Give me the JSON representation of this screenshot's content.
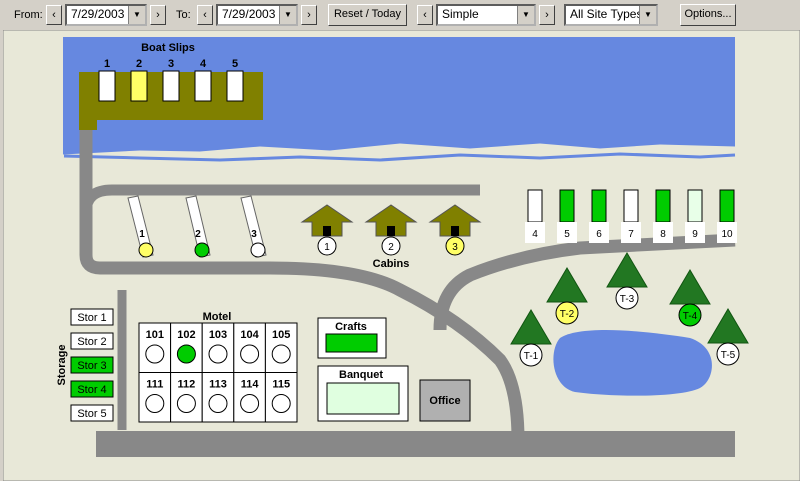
{
  "toolbar": {
    "from_label": "From:",
    "from_date": "7/29/2003",
    "to_label": "To:",
    "to_date": "7/29/2003",
    "reset_label": "Reset / Today",
    "view_value": "Simple",
    "site_type_value": "All Site Types",
    "options_label": "Options..."
  },
  "map": {
    "boat_slips_title": "Boat Slips",
    "boat_slips": [
      {
        "label": "1",
        "status": "available"
      },
      {
        "label": "2",
        "status": "reserved"
      },
      {
        "label": "3",
        "status": "available"
      },
      {
        "label": "4",
        "status": "available"
      },
      {
        "label": "5",
        "status": "available"
      }
    ],
    "rv_sites": [
      {
        "label": "1",
        "status": "reserved"
      },
      {
        "label": "2",
        "status": "occupied"
      },
      {
        "label": "3",
        "status": "available"
      }
    ],
    "cabins_title": "Cabins",
    "cabins": [
      {
        "label": "1",
        "status": "available"
      },
      {
        "label": "2",
        "status": "available"
      },
      {
        "label": "3",
        "status": "reserved"
      }
    ],
    "slots": [
      {
        "label": "4",
        "status": "available"
      },
      {
        "label": "5",
        "status": "occupied"
      },
      {
        "label": "6",
        "status": "occupied"
      },
      {
        "label": "7",
        "status": "available"
      },
      {
        "label": "8",
        "status": "occupied"
      },
      {
        "label": "9",
        "status": "light"
      },
      {
        "label": "10",
        "status": "occupied"
      }
    ],
    "tents": [
      {
        "label": "T-1",
        "status": "available"
      },
      {
        "label": "T-2",
        "status": "reserved"
      },
      {
        "label": "T-3",
        "status": "available"
      },
      {
        "label": "T-4",
        "status": "occupied"
      },
      {
        "label": "T-5",
        "status": "available"
      }
    ],
    "storage_title": "Storage",
    "storage": [
      {
        "label": "Stor 1",
        "status": "available"
      },
      {
        "label": "Stor 2",
        "status": "available"
      },
      {
        "label": "Stor 3",
        "status": "occupied"
      },
      {
        "label": "Stor 4",
        "status": "occupied"
      },
      {
        "label": "Stor 5",
        "status": "available"
      }
    ],
    "motel_title": "Motel",
    "motel_rooms": [
      {
        "label": "101",
        "status": "available"
      },
      {
        "label": "102",
        "status": "occupied"
      },
      {
        "label": "103",
        "status": "available"
      },
      {
        "label": "104",
        "status": "available"
      },
      {
        "label": "105",
        "status": "available"
      },
      {
        "label": "111",
        "status": "available"
      },
      {
        "label": "112",
        "status": "available"
      },
      {
        "label": "113",
        "status": "available"
      },
      {
        "label": "114",
        "status": "available"
      },
      {
        "label": "115",
        "status": "available"
      }
    ],
    "crafts_label": "Crafts",
    "banquet_label": "Banquet",
    "office_label": "Office"
  },
  "colors": {
    "available": "#ffffff",
    "reserved": "#ffff66",
    "occupied": "#00cc00",
    "light": "#e8ffe8",
    "water": "#6688e0",
    "ground": "#e8e8d8",
    "road": "#888888",
    "dock": "#808000"
  }
}
